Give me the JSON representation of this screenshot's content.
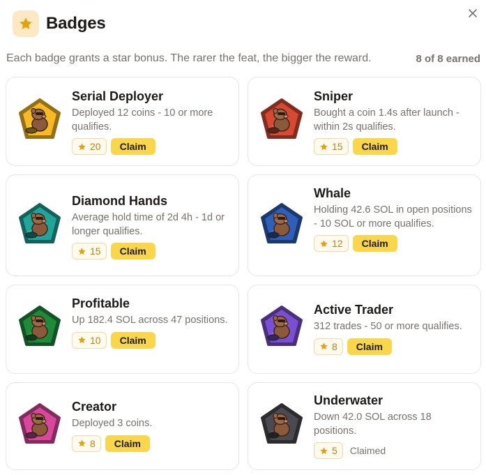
{
  "header": {
    "title": "Badges",
    "subtitle": "Each badge grants a star bonus. The rarer the feat, the bigger the reward.",
    "earned": "8 of 8 earned"
  },
  "colors": {
    "accent": "#f9d64a",
    "star": "#e2a20c",
    "muted_text": "#78716c",
    "border": "#e7e5e4"
  },
  "badges": [
    {
      "title": "Serial Deployer",
      "desc": "Deployed 12 coins - 10 or more qualifies.",
      "stars": "20",
      "action": "Claim",
      "claimed": false,
      "icon": "rocket-badge-icon",
      "color": "#f7b924"
    },
    {
      "title": "Sniper",
      "desc": "Bought a coin 1.4s after launch - within 2s qualifies.",
      "stars": "15",
      "action": "Claim",
      "claimed": false,
      "icon": "pistol-badge-icon",
      "color": "#d64a32"
    },
    {
      "title": "Diamond Hands",
      "desc": "Average hold time of 2d 4h - 1d or longer qualifies.",
      "stars": "15",
      "action": "Claim",
      "claimed": false,
      "icon": "diamond-badge-icon",
      "color": "#1fa59a"
    },
    {
      "title": "Whale",
      "desc": "Holding 42.6 SOL in open positions - 10 SOL or more qualifies.",
      "stars": "12",
      "action": "Claim",
      "claimed": false,
      "icon": "whale-badge-icon",
      "color": "#2f5fb8"
    },
    {
      "title": "Profitable",
      "desc": "Up 182.4 SOL across 47 positions.",
      "stars": "10",
      "action": "Claim",
      "claimed": false,
      "icon": "chart-up-badge-icon",
      "color": "#1f8a3a"
    },
    {
      "title": "Active Trader",
      "desc": "312 trades - 50 or more qualifies.",
      "stars": "8",
      "action": "Claim",
      "claimed": false,
      "icon": "skateboard-badge-icon",
      "color": "#7b4fd1"
    },
    {
      "title": "Creator",
      "desc": "Deployed 3 coins.",
      "stars": "8",
      "action": "Claim",
      "claimed": false,
      "icon": "rocket-pink-badge-icon",
      "color": "#d8479c"
    },
    {
      "title": "Underwater",
      "desc": "Down 42.0 SOL across 18 positions.",
      "stars": "5",
      "action": "Claimed",
      "claimed": true,
      "icon": "chart-down-badge-icon",
      "color": "#4a4a50"
    }
  ]
}
